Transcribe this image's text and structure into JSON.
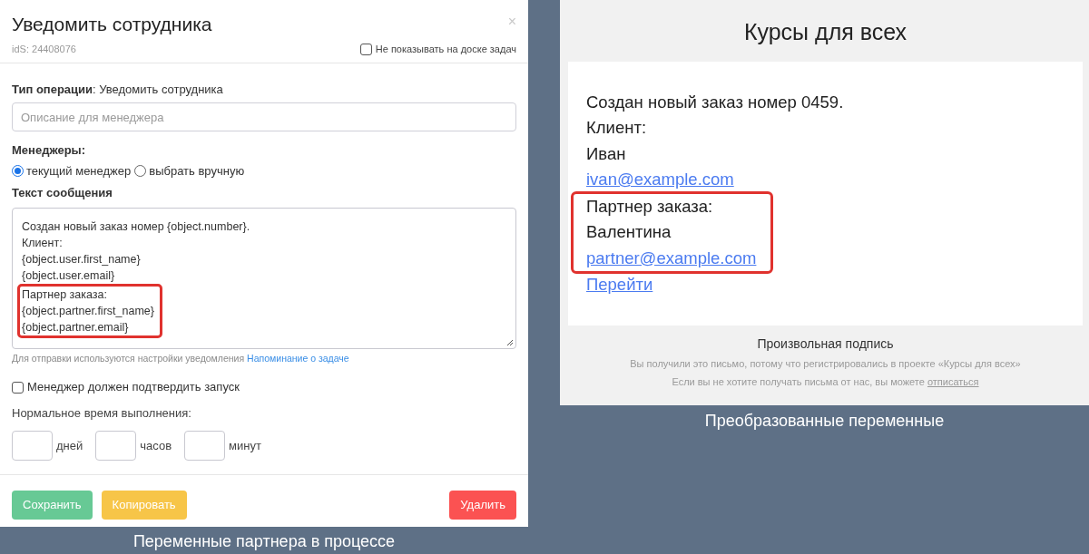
{
  "task_dialog": {
    "title": "Уведомить сотрудника",
    "close": "×",
    "ids": "idS: 24408076",
    "hide_checkbox": {
      "label": "Не показывать на доске задач",
      "checked": false
    },
    "operation_type": "**Тип операции**: Уведомить сотрудника",
    "description_field": {
      "placeholder": "Описание для менеджера"
    },
    "managers": {
      "label": "Менеджеры:",
      "options": [
        {
          "label": "текущий менеджер",
          "selected": true
        },
        {
          "label": "выбрать вручную",
          "selected": false
        }
      ]
    },
    "message": {
      "label": "Текст сообщения",
      "lines": [
        {
          "text": "Создан новый заказ номер {object.number}.",
          "highlighted": false
        },
        {
          "text": "Клиент:",
          "highlighted": false
        },
        {
          "text": "{object.user.first_name}",
          "highlighted": false
        },
        {
          "text": "{object.user.email}",
          "highlighted": false
        },
        {
          "text": "Партнер заказа:",
          "highlighted": true
        },
        {
          "text": "{object.partner.first_name}",
          "highlighted": true
        },
        {
          "text": "{object.partner.email}",
          "highlighted": true
        }
      ]
    },
    "hint": {
      "text": "Для отправки используются настройки уведомления",
      "link": "Напоминание о задаче"
    },
    "confirm_checkbox": {
      "label": "Менеджер должен подтвердить запуск",
      "checked": false
    },
    "duration": {
      "label": "Нормальное время выполнения:",
      "fields": [
        {
          "unit": "дней"
        },
        {
          "unit": "часов"
        },
        {
          "unit": "минут"
        }
      ]
    },
    "buttons": [
      {
        "label": "Сохранить",
        "kind": "save"
      },
      {
        "label": "Копировать",
        "kind": "copy"
      },
      {
        "label": "Удалить",
        "kind": "delete"
      }
    ]
  },
  "left_caption": "Переменные партнера в процессе",
  "email_preview": {
    "header": "Курсы для всех",
    "lines": [
      {
        "text": "Создан новый заказ номер 0459.",
        "kind": "text",
        "highlighted": false
      },
      {
        "text": "Клиент:",
        "kind": "text",
        "highlighted": false
      },
      {
        "text": "Иван",
        "kind": "text",
        "highlighted": false
      },
      {
        "text": "ivan@example.com",
        "kind": "link",
        "highlighted": false
      },
      {
        "text": "Партнер заказа:",
        "kind": "text",
        "highlighted": true
      },
      {
        "text": "Валентина",
        "kind": "text",
        "highlighted": true
      },
      {
        "text": "partner@example.com",
        "kind": "link",
        "highlighted": true
      },
      {
        "text": "Перейти",
        "kind": "link",
        "highlighted": false
      }
    ],
    "signature": "Произвольная подпись",
    "notice": "Вы получили это письмо, потому что регистрировались в проекте «Курсы для всех»",
    "unsubscribe_text": "Если вы не хотите получать письма от нас, вы можете",
    "unsubscribe_link": "отписаться"
  },
  "right_caption": "Преобразованные переменные"
}
